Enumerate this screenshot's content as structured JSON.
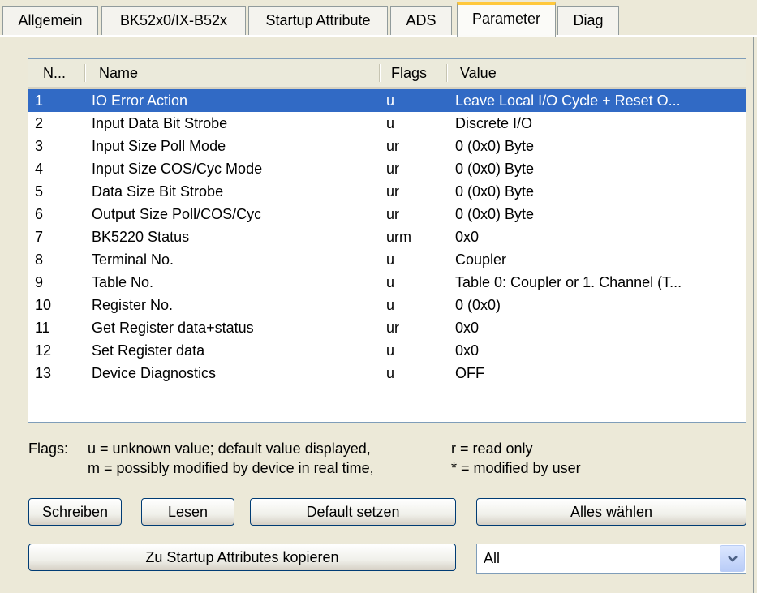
{
  "tabs": [
    {
      "label": "Allgemein",
      "active": false
    },
    {
      "label": "BK52x0/IX-B52x",
      "active": false
    },
    {
      "label": "Startup Attribute",
      "active": false
    },
    {
      "label": "ADS",
      "active": false
    },
    {
      "label": "Parameter",
      "active": true
    },
    {
      "label": "Diag",
      "active": false
    }
  ],
  "table": {
    "columns": [
      "N...",
      "Name",
      "Flags",
      "Value"
    ],
    "selected_row": 0,
    "rows": [
      {
        "no": "1",
        "name": "IO Error Action",
        "flags": "u",
        "value": "Leave Local I/O Cycle + Reset O..."
      },
      {
        "no": "2",
        "name": "Input Data Bit Strobe",
        "flags": "u",
        "value": "Discrete I/O"
      },
      {
        "no": "3",
        "name": "Input Size Poll Mode",
        "flags": "ur",
        "value": "0 (0x0) Byte"
      },
      {
        "no": "4",
        "name": "Input Size COS/Cyc Mode",
        "flags": "ur",
        "value": "0 (0x0) Byte"
      },
      {
        "no": "5",
        "name": "Data Size Bit Strobe",
        "flags": "ur",
        "value": "0 (0x0) Byte"
      },
      {
        "no": "6",
        "name": "Output Size Poll/COS/Cyc",
        "flags": "ur",
        "value": "0 (0x0) Byte"
      },
      {
        "no": "7",
        "name": "BK5220 Status",
        "flags": "urm",
        "value": "0x0"
      },
      {
        "no": "8",
        "name": "Terminal No.",
        "flags": "u",
        "value": "Coupler"
      },
      {
        "no": "9",
        "name": "Table No.",
        "flags": "u",
        "value": "Table 0: Coupler or 1. Channel (T..."
      },
      {
        "no": "10",
        "name": "Register No.",
        "flags": "u",
        "value": "0 (0x0)"
      },
      {
        "no": "11",
        "name": "Get Register data+status",
        "flags": "ur",
        "value": "0x0"
      },
      {
        "no": "12",
        "name": "Set Register data",
        "flags": "u",
        "value": "0x0"
      },
      {
        "no": "13",
        "name": "Device Diagnostics",
        "flags": "u",
        "value": "OFF"
      }
    ]
  },
  "legend": {
    "prefix": "Flags:",
    "u": "u = unknown value; default value displayed,",
    "m": "m = possibly modified by device in real time,",
    "r": "r = read only",
    "star": "* = modified by user"
  },
  "buttons": {
    "schreiben": "Schreiben",
    "lesen": "Lesen",
    "default": "Default setzen",
    "alles": "Alles wählen",
    "kopieren": "Zu Startup Attributes kopieren"
  },
  "filter_combo": {
    "value": "All"
  },
  "colors": {
    "selection": "#316ac5",
    "active_tab_accent": "#ffc83c"
  }
}
